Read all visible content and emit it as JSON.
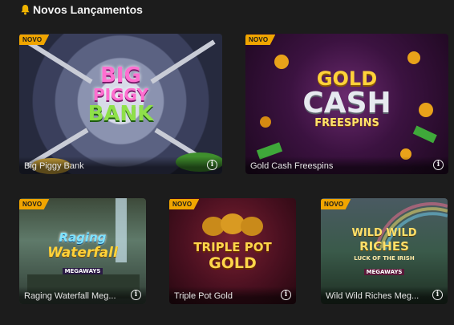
{
  "section": {
    "title": "Novos Lançamentos",
    "icon": "bell-icon"
  },
  "games": [
    {
      "title": "Big Piggy Bank",
      "badge": "NOVO",
      "logo_lines": [
        "BIG",
        "PIGGY",
        "BANK"
      ]
    },
    {
      "title": "Gold Cash Freespins",
      "badge": "NOVO",
      "logo_lines": [
        "GOLD",
        "CASH",
        "FREESPINS"
      ]
    },
    {
      "title": "Raging Waterfall Meg...",
      "badge": "NOVO",
      "logo_lines": [
        "Raging",
        "Waterfall",
        "MEGAWAYS"
      ]
    },
    {
      "title": "Triple Pot Gold",
      "badge": "NOVO",
      "logo_lines": [
        "TRIPLE POT",
        "GOLD"
      ]
    },
    {
      "title": "Wild Wild Riches Meg...",
      "badge": "NOVO",
      "logo_lines": [
        "WILD WILD",
        "RICHES",
        "LUCK OF THE IRISH",
        "MEGAWAYS"
      ]
    }
  ],
  "colors": {
    "background": "#1c1c1c",
    "badge": "#f0a500"
  }
}
